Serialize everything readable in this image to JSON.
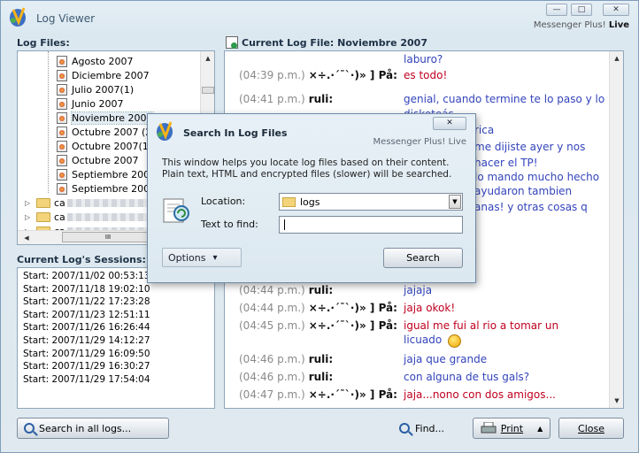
{
  "window": {
    "title": "Log Viewer",
    "brand_prefix": "Messenger Plus!",
    "brand_suffix": "Live",
    "minimize_glyph": "—",
    "maximize_glyph": "□",
    "close_glyph": "✕"
  },
  "log_files": {
    "label": "Log Files:",
    "items": [
      {
        "label": "Agosto 2007"
      },
      {
        "label": "Diciembre 2007"
      },
      {
        "label": "Julio 2007(1)"
      },
      {
        "label": "Junio 2007"
      },
      {
        "label": "Noviembre 2007",
        "selected": true
      },
      {
        "label": "Octubre 2007 (2)"
      },
      {
        "label": "Octubre 2007(1)"
      },
      {
        "label": "Octubre 2007"
      },
      {
        "label": "Septiembre 2007("
      },
      {
        "label": "Septiembre 2007"
      }
    ],
    "folders": [
      {
        "prefix": "ca",
        "expand_glyph": "▷"
      },
      {
        "prefix": "ca",
        "expand_glyph": "▷"
      },
      {
        "prefix": "ca",
        "expand_glyph": "▷"
      }
    ],
    "scroll_glyphs": {
      "up": "▲",
      "down": "▼",
      "left": "◀",
      "right": "▶",
      "thumb": "III"
    }
  },
  "sessions": {
    "label": "Current Log's Sessions:",
    "items": [
      "Start: 2007/11/02 00:53:13",
      "Start: 2007/11/18 19:02:10",
      "Start: 2007/11/22 17:23:28",
      "Start: 2007/11/23 12:51:11",
      "Start: 2007/11/26 16:26:44",
      "Start: 2007/11/29 14:12:27",
      "Start: 2007/11/29 16:09:50",
      "Start: 2007/11/29 16:30:27",
      "Start: 2007/11/29 17:54:04"
    ]
  },
  "current_log": {
    "label": "Current Log File: Noviembre 2007",
    "rows": [
      {
        "time": "",
        "nick": "",
        "msg": "laburo?",
        "color": "blue"
      },
      {
        "time": "(04:39 p.m.)",
        "nick": "×÷.·´¯`·)» ] På:",
        "msg": "es todo!",
        "color": "red"
      },
      {
        "time": "(04:41 p.m.)",
        "nick": "ruli:",
        "msg": "genial, cuando termine te lo paso y lo",
        "color": "blue"
      },
      {
        "time": "",
        "nick": "",
        "msg": "disketeás",
        "color": "blue"
      },
      {
        "time": "(04:44 p.m.)",
        "nick": "ruli:",
        "msg": "jajaja",
        "color": "blue"
      },
      {
        "time": "(04:44 p.m.)",
        "nick": "×÷.·´¯`·)» ] På:",
        "msg": "jaja okok!",
        "color": "red"
      },
      {
        "time": "(04:45 p.m.)",
        "nick": "×÷.·´¯`·)» ] På:",
        "msg": "igual me fui al rio a tomar un",
        "color": "red"
      },
      {
        "time": "",
        "nick": "",
        "msg": "licuado",
        "color": "blue",
        "emoticon": true
      },
      {
        "time": "(04:46 p.m.)",
        "nick": "ruli:",
        "msg": "jaja que grande",
        "color": "blue"
      },
      {
        "time": "(04:46 p.m.)",
        "nick": "ruli:",
        "msg": "con alguna de tus gals?",
        "color": "blue"
      },
      {
        "time": "(04:47 p.m.)",
        "nick": "×÷.·´¯`·)» ] På:",
        "msg": "jaja...nono con dos amigos...",
        "color": "red"
      }
    ],
    "partial_lines": [
      "rica",
      "me dijiste ayer y nos",
      "hacer el TP!",
      "lo mando mucho hecho",
      "ayudaron tambien",
      "anas! y otras cosas q"
    ],
    "scroll_glyphs": {
      "up": "▲",
      "down": "▼"
    }
  },
  "bottom": {
    "search_all_label": "Search in all logs...",
    "find_label": "Find...",
    "print_label": "Print",
    "print_dropdown_glyph": "▲",
    "close_label": "Close"
  },
  "dialog": {
    "title": "Search In Log Files",
    "brand": "Messenger Plus! Live",
    "close_glyph": "✕",
    "description": "This window helps you locate log files based on their content. Plain text, HTML and encrypted files (slower) will be searched.",
    "location_label": "Location:",
    "location_value": "logs",
    "location_arrow": "▼",
    "text_label": "Text to find:",
    "text_value": "",
    "options_label": "Options",
    "options_glyph": "▾",
    "search_label": "Search"
  }
}
